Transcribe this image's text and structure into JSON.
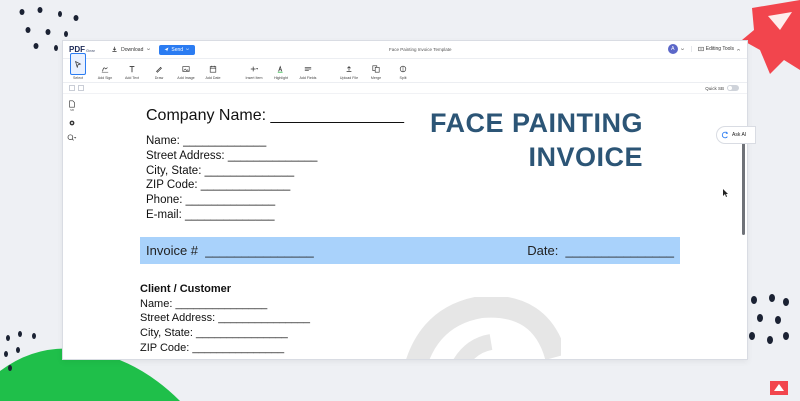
{
  "app": {
    "logo": {
      "main": "PDF",
      "sub": "Gear"
    },
    "download_label": "Download",
    "send_label": "Send",
    "doc_title": "Face Painting Invoice Template",
    "avatar_initial": "A",
    "editing_tools_label": "Editing Tools"
  },
  "toolbar": {
    "tools": [
      {
        "label": "Select",
        "icon": "select-icon"
      },
      {
        "label": "Add Sign",
        "icon": "sign-icon"
      },
      {
        "label": "Add Text",
        "icon": "text-icon"
      },
      {
        "label": "Draw",
        "icon": "pen-icon"
      },
      {
        "label": "Add Image",
        "icon": "image-icon"
      },
      {
        "label": "Add Date",
        "icon": "calendar-icon"
      },
      {
        "label": "Insert Item",
        "icon": "plus-icon"
      },
      {
        "label": "Highlight",
        "icon": "highlight-icon"
      },
      {
        "label": "Add Fields",
        "icon": "fields-icon"
      },
      {
        "label": "Upload File",
        "icon": "upload-icon"
      },
      {
        "label": "Merge",
        "icon": "merge-icon"
      },
      {
        "label": "Split",
        "icon": "split-icon"
      }
    ]
  },
  "subbar": {
    "quick_sb_label": "Quick SB"
  },
  "sidebar": {
    "items": [
      {
        "label": "SB",
        "icon": "document-icon"
      },
      {
        "label": "",
        "icon": "gear-icon"
      },
      {
        "label": "",
        "icon": "zoom-icon"
      }
    ]
  },
  "ask_ai_label": "Ask AI",
  "document": {
    "company": "Company Name: _______________",
    "info_lines": [
      "Name: _____________",
      "Street Address: ______________",
      "City, State: ______________",
      "ZIP Code: ______________",
      "Phone: ______________",
      "E-mail: ______________"
    ],
    "title_line1": "FACE PAINTING",
    "title_line2": "INVOICE",
    "invoice_label": "Invoice #  _______________",
    "date_label": "Date:  _______________",
    "client_heading": "Client / Customer",
    "client_lines": [
      "Name: _______________",
      "Street Address: _______________",
      "City, State: _______________",
      "ZIP Code: _______________"
    ]
  },
  "colors": {
    "accent": "#2b7cf2",
    "title": "#2c5576",
    "band": "#a9d2fb"
  }
}
